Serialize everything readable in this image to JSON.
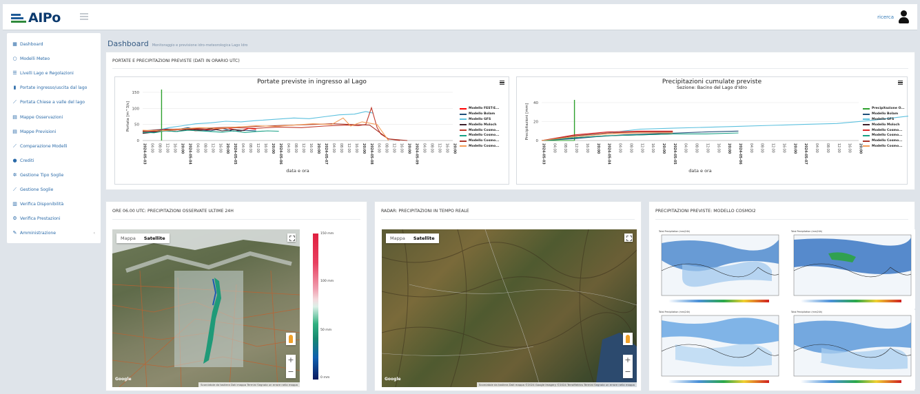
{
  "header": {
    "logo_text": "AIPo",
    "user_name": "ricerca",
    "colors": {
      "brand": "#0c3a6e",
      "accent": "#2a6aa8"
    }
  },
  "sidebar": {
    "items": [
      {
        "label": "Dashboard",
        "icon": "dashboard-icon"
      },
      {
        "label": "Modelli Meteo",
        "icon": "circle-icon"
      },
      {
        "label": "Livelli Lago e Regolazioni",
        "icon": "list-icon"
      },
      {
        "label": "Portate ingresso/uscita dal lago",
        "icon": "bar-chart-icon"
      },
      {
        "label": "Portata Chiese a valle del lago",
        "icon": "line-chart-icon"
      },
      {
        "label": "Mappe Osservazioni",
        "icon": "map-icon"
      },
      {
        "label": "Mappe Previsioni",
        "icon": "map-icon"
      },
      {
        "label": "Comparazione Modelli",
        "icon": "line-chart-icon"
      },
      {
        "label": "Crediti",
        "icon": "info-icon"
      },
      {
        "label": "Gestione Tipo Soglie",
        "icon": "gears-icon"
      },
      {
        "label": "Gestione Soglie",
        "icon": "line-chart-icon"
      },
      {
        "label": "Verifica Disponibilità",
        "icon": "bar-chart-icon"
      },
      {
        "label": "Verifica Prestazioni",
        "icon": "gear-icon"
      },
      {
        "label": "Amministrazione",
        "icon": "edit-icon"
      }
    ]
  },
  "dashboard": {
    "title": "Dashboard",
    "subtitle": "Monitoraggio e previsione idro-meteorologica Lago Idro"
  },
  "top_panel": {
    "title": "PORTATE E PRECIPITAZIONI PREVISTE (DATI IN ORARIO UTC)"
  },
  "chart_data": [
    {
      "type": "line",
      "title": "Portate previste in ingresso al Lago",
      "xlabel": "data e ora",
      "ylabel": "Portata [m^3/s]",
      "ylim": [
        0,
        150
      ],
      "yticks": [
        "150",
        "100",
        "50",
        "0"
      ],
      "xticks": [
        "2024-05-03",
        "04:00",
        "08:00",
        "12:00",
        "16:00",
        "20:00",
        "2024-05-04",
        "04:00",
        "08:00",
        "12:00",
        "16:00",
        "20:00",
        "2024-05-05",
        "04:00",
        "08:00",
        "12:00",
        "16:00",
        "20:00",
        "2024-05-06",
        "04:00",
        "08:00",
        "12:00",
        "16:00",
        "20:00",
        "2024-05-07",
        "04:00",
        "08:00",
        "12:00",
        "16:00",
        "20:00",
        "2024-05-08",
        "04:00",
        "08:00",
        "12:00",
        "16:00",
        "20:00",
        "2024-05-09",
        "04:00",
        "08:00",
        "12:00",
        "16:00",
        "20:00"
      ],
      "grid": true,
      "legend": "right",
      "x_unit": "hours since 2024-05-03 00:00 UTC",
      "now_marker_x": 10,
      "series": [
        {
          "name": "Modello FEST-E...",
          "color": "#ff0000",
          "x": [
            0,
            6,
            10,
            16,
            22,
            28,
            36,
            44,
            52,
            56,
            60
          ],
          "values": [
            28,
            26,
            34,
            32,
            36,
            30,
            34,
            40,
            30,
            38,
            35
          ]
        },
        {
          "name": "Modello Bolam",
          "color": "#1f4e79",
          "x": [
            0,
            6,
            12,
            18,
            24,
            30,
            36,
            42,
            48,
            54,
            60
          ],
          "values": [
            25,
            28,
            36,
            34,
            40,
            33,
            30,
            38,
            29,
            32,
            30
          ]
        },
        {
          "name": "Modello GFS",
          "color": "#5bc0de",
          "x": [
            0,
            10,
            14,
            20,
            28,
            36,
            44,
            52,
            60,
            70,
            80,
            88,
            96,
            104,
            112,
            118,
            122
          ],
          "values": [
            30,
            35,
            40,
            45,
            52,
            55,
            60,
            58,
            62,
            66,
            70,
            68,
            74,
            80,
            82,
            90,
            85
          ]
        },
        {
          "name": "Modello Moloch",
          "color": "#3b1f2b",
          "x": [
            0,
            6,
            12,
            18,
            24,
            30,
            36,
            42,
            48,
            54
          ],
          "values": [
            22,
            26,
            30,
            28,
            35,
            32,
            37,
            30,
            34,
            31
          ]
        },
        {
          "name": "Modello Cosmo...",
          "color": "#c0392b",
          "x": [
            0,
            12,
            24,
            36,
            48,
            60,
            72,
            84,
            96,
            108,
            114,
            118,
            121,
            124,
            126,
            130,
            136
          ],
          "values": [
            28,
            30,
            36,
            34,
            40,
            38,
            42,
            40,
            45,
            48,
            46,
            50,
            102,
            40,
            20,
            5,
            0
          ]
        },
        {
          "name": "Modello Cosmo...",
          "color": "#16a085",
          "x": [
            0,
            6,
            12,
            18,
            24,
            30,
            36,
            42,
            48,
            54,
            60,
            66,
            72
          ],
          "values": [
            26,
            24,
            30,
            28,
            32,
            30,
            28,
            26,
            30,
            25,
            28,
            30,
            29
          ]
        },
        {
          "name": "Modello Cosmo...",
          "color": "#a93226",
          "x": [
            0,
            10,
            20,
            30,
            40,
            50,
            60,
            70,
            80,
            90,
            100,
            110,
            120,
            130,
            140
          ],
          "values": [
            30,
            34,
            36,
            38,
            40,
            42,
            44,
            46,
            48,
            50,
            52,
            50,
            48,
            5,
            0
          ]
        },
        {
          "name": "Modello Cosmo...",
          "color": "#f39c55",
          "x": [
            0,
            10,
            20,
            30,
            40,
            50,
            60,
            70,
            80,
            90,
            100,
            106,
            110,
            116,
            124,
            130
          ],
          "values": [
            32,
            30,
            36,
            40,
            38,
            42,
            46,
            44,
            48,
            52,
            50,
            70,
            45,
            58,
            50,
            0
          ]
        }
      ]
    },
    {
      "type": "line",
      "title": "Precipitazioni cumulate previste",
      "subtitle": "Sezione: Bacino del Lago d'Idro",
      "xlabel": "data e ora",
      "ylabel": "Precipitazioni [mm]",
      "ylim": [
        0,
        40
      ],
      "yticks": [
        "40",
        "20",
        "0"
      ],
      "xticks": [
        "2024-05-03",
        "04:00",
        "08:00",
        "12:00",
        "16:00",
        "20:00",
        "2024-05-04",
        "04:00",
        "08:00",
        "12:00",
        "16:00",
        "20:00",
        "2024-05-05",
        "04:00",
        "08:00",
        "12:00",
        "16:00",
        "20:00",
        "2024-05-06",
        "04:00",
        "08:00",
        "12:00",
        "16:00",
        "20:00",
        "2024-05-07",
        "04:00",
        "08:00",
        "12:00",
        "16:00",
        "20:00"
      ],
      "grid": true,
      "legend": "right",
      "x_unit": "hours since 2024-05-03 00:00 UTC",
      "now_marker_x": 12,
      "series": [
        {
          "name": "Precipitazione O...",
          "color": "#2ca02c",
          "x": [
            0,
            12
          ],
          "values": [
            0,
            0
          ]
        },
        {
          "name": "Modello Bolam",
          "color": "#1f4e79",
          "x": [
            0,
            12,
            20,
            30,
            40,
            50,
            60,
            72
          ],
          "values": [
            0,
            2,
            4,
            6,
            7,
            8,
            9,
            10
          ]
        },
        {
          "name": "Modello GFS",
          "color": "#5bc0de",
          "x": [
            0,
            12,
            24,
            36,
            48,
            60,
            72,
            84,
            96,
            108,
            120,
            132,
            144,
            156,
            168
          ],
          "values": [
            0,
            4,
            8,
            12,
            13,
            14,
            15,
            16,
            17,
            18,
            21,
            25,
            29,
            33,
            37
          ]
        },
        {
          "name": "Modello Moloch",
          "color": "#3b1f2b",
          "x": [
            0,
            12,
            24,
            36,
            48
          ],
          "values": [
            0,
            3,
            5,
            6,
            7
          ]
        },
        {
          "name": "Modello Cosmo...",
          "color": "#d62728",
          "x": [
            0,
            12,
            24,
            36,
            48
          ],
          "values": [
            0,
            6,
            9,
            10,
            10
          ]
        },
        {
          "name": "Modello Cosmo...",
          "color": "#16a085",
          "x": [
            0,
            12,
            24,
            36,
            48,
            60,
            72
          ],
          "values": [
            0,
            3,
            5,
            6,
            7,
            7,
            8
          ]
        },
        {
          "name": "Modello Cosmo...",
          "color": "#a93226",
          "x": [
            0,
            12,
            24,
            36,
            48
          ],
          "values": [
            0,
            5,
            8,
            9,
            9
          ]
        },
        {
          "name": "Modello Cosmo...",
          "color": "#f39c55",
          "x": [
            0,
            12,
            24,
            36,
            48
          ],
          "values": [
            0,
            4,
            7,
            8,
            8
          ]
        }
      ]
    }
  ],
  "panels": {
    "observed": {
      "title": "ORE 06.00 UTC: PRECIPITAZIONI OSSERVATE ULTIME 24H",
      "toggle_map": "Mappa",
      "toggle_sat": "Satellite",
      "google": "Google",
      "footer": "Scorciatoie da tastiera   Dati mappa   Termini   Segnala un errore nella mappa",
      "scale_labels": [
        "150 mm",
        "100 mm",
        "50 mm",
        "0 mm"
      ]
    },
    "radar": {
      "title": "RADAR: PRECIPITAZIONI IN TEMPO REALE",
      "toggle_map": "Mappa",
      "toggle_sat": "Satellite",
      "google": "Google",
      "footer": "Scorciatoie da tastiera   Dati mappa ©2024 Google Imagery ©2024 TerraMetrics   Termini   Segnala un errore nella mappa"
    },
    "forecast": {
      "title": "PRECIPITAZIONI PREVISTE: MODELLO COSMOI2",
      "cell_title": "Total Precipitation (mm/24h)"
    }
  }
}
